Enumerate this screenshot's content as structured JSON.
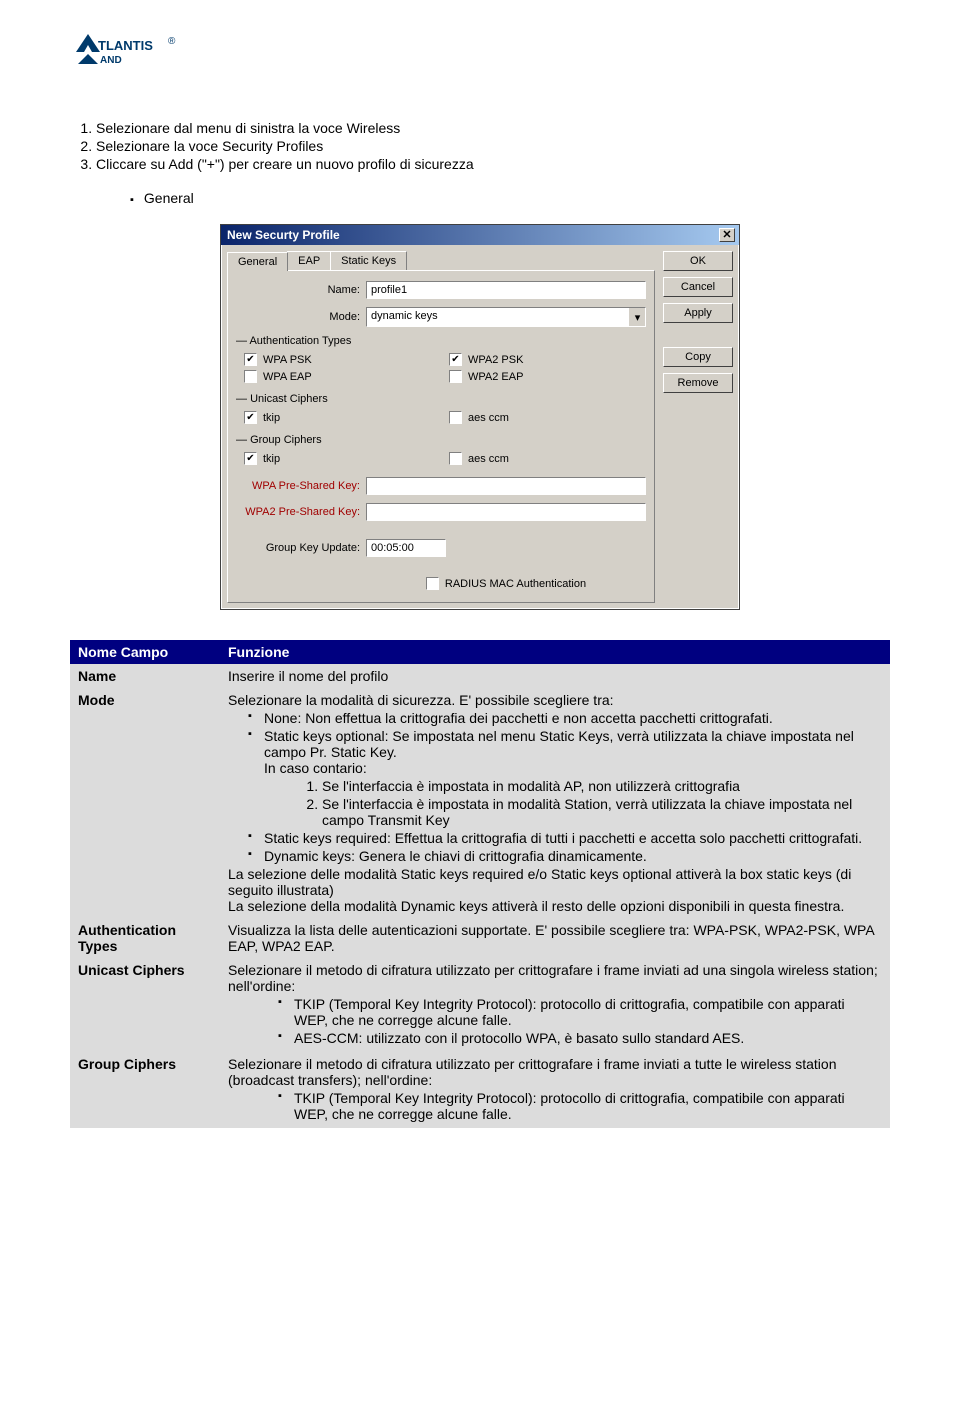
{
  "logo": {
    "main": "TLANTIS",
    "sub": "AND"
  },
  "steps": [
    "Selezionare dal menu di sinistra la voce Wireless",
    "Selezionare la voce Security Profiles",
    "Cliccare su Add (\"+\") per creare un nuovo profilo di sicurezza"
  ],
  "general_bullet": "General",
  "dialog": {
    "title": "New Securty Profile",
    "close": "X",
    "buttons": {
      "ok": "OK",
      "cancel": "Cancel",
      "apply": "Apply",
      "copy": "Copy",
      "remove": "Remove"
    },
    "tabs": {
      "general": "General",
      "eap": "EAP",
      "static_keys": "Static Keys"
    },
    "labels": {
      "name": "Name:",
      "mode": "Mode:",
      "wpa_psk_label": "WPA Pre-Shared Key:",
      "wpa2_psk_label": "WPA2 Pre-Shared Key:",
      "group_key_update": "Group Key Update:"
    },
    "name_value": "profile1",
    "mode_value": "dynamic keys",
    "group_key_update_value": "00:05:00",
    "sections": {
      "auth": "Authentication Types",
      "unicast": "Unicast Ciphers",
      "group": "Group Ciphers"
    },
    "checks": {
      "wpa_psk": "WPA PSK",
      "wpa2_psk": "WPA2 PSK",
      "wpa_eap": "WPA EAP",
      "wpa2_eap": "WPA2 EAP",
      "tkip": "tkip",
      "aes": "aes ccm",
      "radius": "RADIUS MAC Authentication"
    }
  },
  "table": {
    "head": {
      "c1": "Nome Campo",
      "c2": "Funzione"
    },
    "rows": {
      "name": {
        "label": "Name",
        "desc": "Inserire il nome del profilo"
      },
      "mode": {
        "label": "Mode",
        "intro": "Selezionare la modalità di sicurezza. E' possibile scegliere tra:",
        "none": "None: Non effettua la crittografia dei pacchetti e non accetta pacchetti crittografati.",
        "static_opt": "Static keys optional: Se impostata nel menu Static Keys, verrà utilizzata la chiave impostata nel campo Pr. Static Key.",
        "in_caso": "In caso contario:",
        "case1": "Se l'interfaccia è impostata in modalità AP, non utilizzerà crittografia",
        "case2": "Se l'interfaccia è impostata in modalità Station, verrà utilizzata la chiave impostata nel campo Transmit Key",
        "static_req": "Static keys required: Effettua la crittografia di tutti i pacchetti e accetta solo pacchetti crittografati.",
        "dynamic": "Dynamic keys: Genera le chiavi di crittografia dinamicamente.",
        "post1": "La selezione delle modalità Static keys required e/o Static keys optional attiverà la box static keys (di seguito illustrata)",
        "post2": "La selezione della modalità Dynamic keys attiverà il resto delle opzioni disponibili in questa finestra."
      },
      "auth": {
        "label": "Authentication Types",
        "desc": "Visualizza la lista delle autenticazioni supportate. E' possibile scegliere tra: WPA-PSK, WPA2-PSK, WPA EAP, WPA2 EAP."
      },
      "unicast": {
        "label": "Unicast Ciphers",
        "intro": "Selezionare il metodo di cifratura utilizzato per crittografare i frame inviati ad una singola wireless station; nell'ordine:",
        "tkip": "TKIP (Temporal Key Integrity Protocol): protocollo di crittografia, compatibile con apparati WEP, che ne corregge alcune falle.",
        "aes": "AES-CCM: utilizzato con il protocollo WPA, è basato sullo standard AES."
      },
      "group": {
        "label": "Group Ciphers",
        "intro": "Selezionare il metodo di cifratura utilizzato per crittografare i frame inviati a tutte le wireless station (broadcast transfers); nell'ordine:",
        "tkip": "TKIP (Temporal Key Integrity Protocol): protocollo di crittografia, compatibile con apparati WEP, che ne corregge alcune falle."
      }
    }
  }
}
